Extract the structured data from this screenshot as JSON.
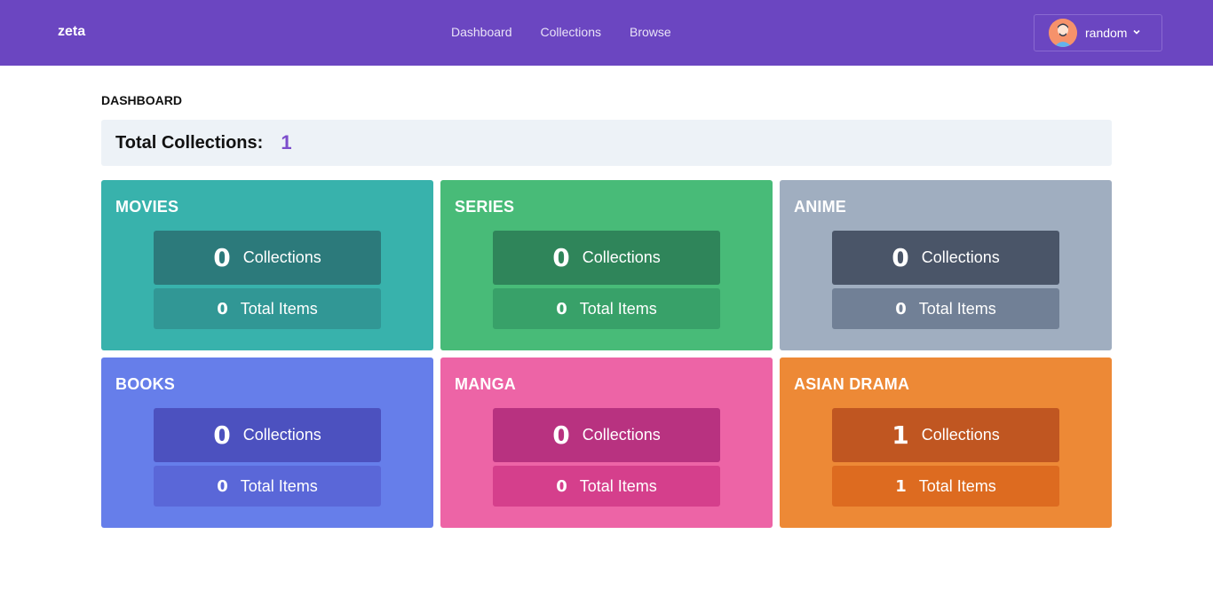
{
  "nav": {
    "brand": "zeta",
    "links": [
      "Dashboard",
      "Collections",
      "Browse"
    ],
    "user": "random"
  },
  "page": {
    "title": "DASHBOARD",
    "total_label": "Total Collections:",
    "total_value": "1"
  },
  "cards": [
    {
      "title": "MOVIES",
      "collections": "0",
      "collections_label": "Collections",
      "items": "0",
      "items_label": "Total Items",
      "bg": "#38b2ac",
      "top": "#2c7a7b",
      "bottom": "#319795"
    },
    {
      "title": "SERIES",
      "collections": "0",
      "collections_label": "Collections",
      "items": "0",
      "items_label": "Total Items",
      "bg": "#48bb78",
      "top": "#2f855a",
      "bottom": "#38a169"
    },
    {
      "title": "ANIME",
      "collections": "0",
      "collections_label": "Collections",
      "items": "0",
      "items_label": "Total Items",
      "bg": "#a0aec0",
      "top": "#4a5568",
      "bottom": "#718096"
    },
    {
      "title": "BOOKS",
      "collections": "0",
      "collections_label": "Collections",
      "items": "0",
      "items_label": "Total Items",
      "bg": "#667eea",
      "top": "#4c51bf",
      "bottom": "#5a67d8"
    },
    {
      "title": "MANGA",
      "collections": "0",
      "collections_label": "Collections",
      "items": "0",
      "items_label": "Total Items",
      "bg": "#ed64a6",
      "top": "#b83280",
      "bottom": "#d53f8c"
    },
    {
      "title": "ASIAN DRAMA",
      "collections": "1",
      "collections_label": "Collections",
      "items": "1",
      "items_label": "Total Items",
      "bg": "#ed8936",
      "top": "#c05621",
      "bottom": "#dd6b20"
    }
  ],
  "icons": {
    "avatar": "user-avatar",
    "chevron": "chevron-down-icon"
  },
  "colors": {
    "navbar": "#6b46c1",
    "accent": "#7c4dcc",
    "summary_bg": "#edf2f7"
  }
}
